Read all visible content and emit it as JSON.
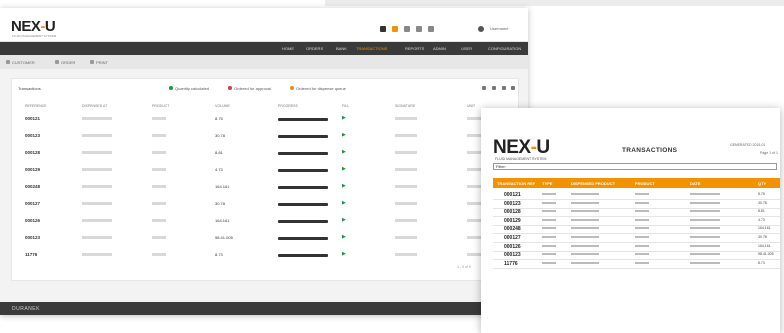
{
  "app": {
    "logo": {
      "text_left": "NEX",
      "text_mid": "-",
      "text_right": "U"
    },
    "logo_subtitle": "FLUID MANAGEMENT SYSTEM",
    "header_user": "Username",
    "nav": [
      {
        "label": "HOME"
      },
      {
        "label": "ORDERS"
      },
      {
        "label": "BANK"
      },
      {
        "label": "TRANSACTIONS"
      },
      {
        "label": "REPORTS"
      },
      {
        "label": "ADMIN"
      },
      {
        "label": "USER"
      },
      {
        "label": "CONFIGURATION"
      }
    ],
    "subnav": [
      {
        "label": "CUSTOMER"
      },
      {
        "label": "ORDER"
      },
      {
        "label": "PRINT"
      }
    ],
    "footer": "DURANEK"
  },
  "transactions_panel": {
    "title": "Transactions",
    "legend": [
      {
        "label": "Quantity calculated",
        "color": "#1a9a3a"
      },
      {
        "label": "Ordered for approval",
        "color": "#e0354b"
      },
      {
        "label": "Ordered for dispense queue",
        "color": "#f39200"
      }
    ],
    "columns": [
      "REFERENCE",
      "DISPENSED AT",
      "PRODUCT",
      "VOLUME",
      "PROGRESS",
      "FILL",
      "SIGNATURE",
      "UNIT"
    ],
    "rows": [
      {
        "ref": "000121",
        "amount": "8.75"
      },
      {
        "ref": "000123",
        "amount": "30.78"
      },
      {
        "ref": "000128",
        "amount": "8.81"
      },
      {
        "ref": "000129",
        "amount": "4.73"
      },
      {
        "ref": "000248",
        "amount": "164.161"
      },
      {
        "ref": "000127",
        "amount": "30.78"
      },
      {
        "ref": "000126",
        "amount": "164.161"
      },
      {
        "ref": "000123",
        "amount": "98.41.005"
      },
      {
        "ref": "11776",
        "amount": "8.73"
      }
    ],
    "pager": "1 - 9 of 9"
  },
  "report": {
    "title": "TRANSACTIONS",
    "generated": "GENERATED 2015-01",
    "page": "Page 1 of 1",
    "filter": "Filter:",
    "columns": [
      "TRANSACTION REF",
      "TYPE",
      "DISPENSED PRODUCT",
      "PRODUCT",
      "DATE",
      "QTY"
    ],
    "rows": [
      {
        "ref": "000121",
        "qty": "8.75"
      },
      {
        "ref": "000123",
        "qty": "30.78"
      },
      {
        "ref": "000128",
        "qty": "8.81"
      },
      {
        "ref": "000129",
        "qty": "4.73"
      },
      {
        "ref": "000248",
        "qty": "164.161"
      },
      {
        "ref": "000127",
        "qty": "30.78"
      },
      {
        "ref": "000126",
        "qty": "164.161"
      },
      {
        "ref": "000123",
        "qty": "98.41.005"
      },
      {
        "ref": "11776",
        "qty": "8.73"
      }
    ]
  }
}
